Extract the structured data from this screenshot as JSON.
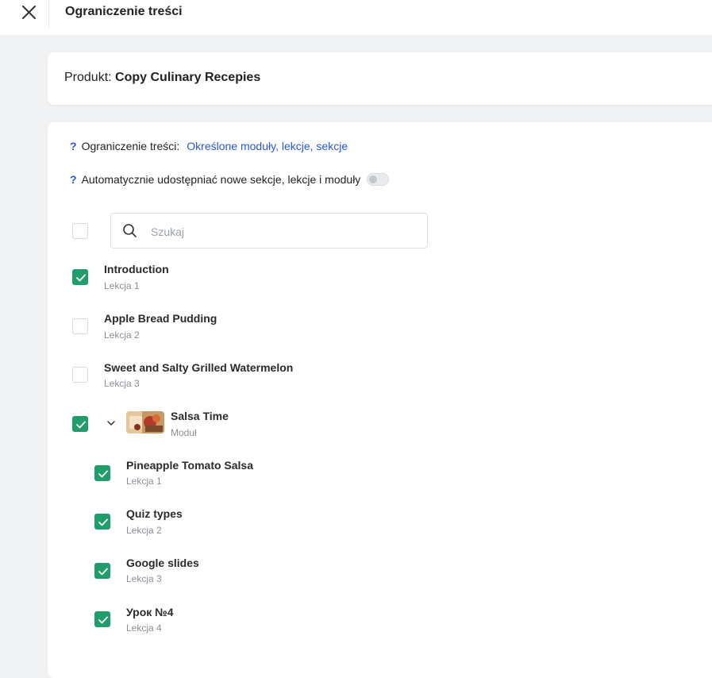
{
  "header": {
    "title": "Ograniczenie treści",
    "close_icon": "close-icon"
  },
  "product": {
    "label": "Produkt:",
    "name": "Copy Culinary Recepies"
  },
  "restriction": {
    "question_mark": "?",
    "label": "Ograniczenie treści:",
    "value": "Określone moduły, lekcje, sekcje"
  },
  "auto_share": {
    "question_mark": "?",
    "label": "Automatycznie udostępniać nowe sekcje, lekcje i moduły",
    "enabled": false
  },
  "search": {
    "placeholder": "Szukaj",
    "value": "",
    "icon": "search-icon"
  },
  "select_all_checked": false,
  "items": [
    {
      "title": "Introduction",
      "subtitle": "Lekcja 1",
      "checked": true
    },
    {
      "title": "Apple Bread Pudding",
      "subtitle": "Lekcja 2",
      "checked": false
    },
    {
      "title": "Sweet and Salty Grilled Watermelon",
      "subtitle": "Lekcja 3",
      "checked": false
    }
  ],
  "module": {
    "title": "Salsa Time",
    "subtitle": "Moduł",
    "checked": true,
    "expanded": true,
    "children": [
      {
        "title": "Pineapple Tomato Salsa",
        "subtitle": "Lekcja 1",
        "checked": true
      },
      {
        "title": "Quiz types",
        "subtitle": "Lekcja 2",
        "checked": true
      },
      {
        "title": "Google slides",
        "subtitle": "Lekcja 3",
        "checked": true
      },
      {
        "title": "Урок №4",
        "subtitle": "Lekcja 4",
        "checked": true
      }
    ]
  },
  "colors": {
    "accent_green": "#1f9d6b",
    "link_blue": "#2557d6",
    "background": "#f1f2f4"
  }
}
